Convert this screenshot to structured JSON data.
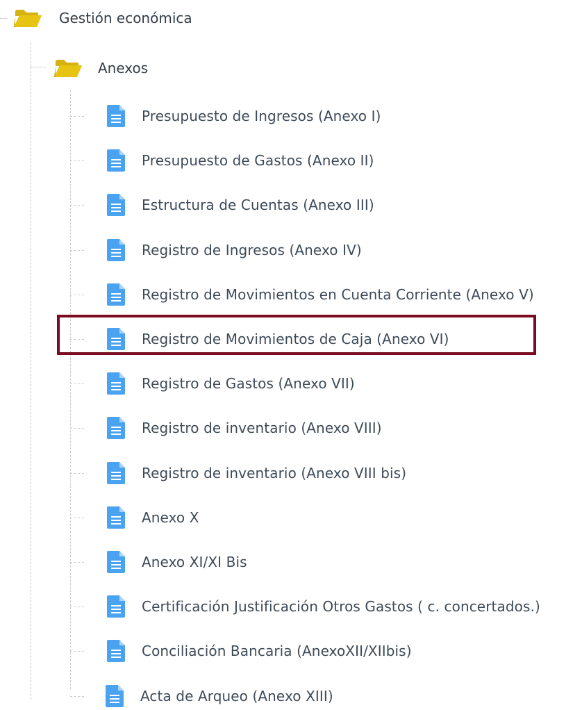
{
  "tree": {
    "root": {
      "label": "Gestión económica",
      "icon": "folder-open-icon"
    },
    "folder": {
      "label": "Anexos",
      "icon": "folder-open-icon"
    },
    "files": [
      {
        "label": "Presupuesto de Ingresos (Anexo I)",
        "icon": "file-text-icon"
      },
      {
        "label": "Presupuesto de Gastos (Anexo II)",
        "icon": "file-text-icon"
      },
      {
        "label": "Estructura de Cuentas (Anexo III)",
        "icon": "file-text-icon"
      },
      {
        "label": "Registro de Ingresos (Anexo IV)",
        "icon": "file-text-icon"
      },
      {
        "label": "Registro de Movimientos en Cuenta Corriente (Anexo V)",
        "icon": "file-text-icon"
      },
      {
        "label": "Registro de Movimientos de Caja (Anexo VI)",
        "icon": "file-text-icon",
        "highlighted": true
      },
      {
        "label": "Registro de Gastos (Anexo VII)",
        "icon": "file-text-icon"
      },
      {
        "label": "Registro de inventario (Anexo VIII)",
        "icon": "file-text-icon"
      },
      {
        "label": "Registro de inventario (Anexo VIII bis)",
        "icon": "file-text-icon"
      },
      {
        "label": "Anexo X",
        "icon": "file-text-icon"
      },
      {
        "label": "Anexo XI/XI Bis",
        "icon": "file-text-icon"
      },
      {
        "label": "Certificación Justificación Otros Gastos ( c. concertados.)",
        "icon": "file-text-icon"
      },
      {
        "label": "Conciliación Bancaria (AnexoXII/XIIbis)",
        "icon": "file-text-icon"
      },
      {
        "label": "Acta de Arqueo (Anexo XIII)",
        "icon": "file-text-icon"
      }
    ]
  },
  "colors": {
    "folder": "#e7c312",
    "file": "#4aa3f0",
    "highlight_border": "#7b0b20",
    "text": "#3d4a57",
    "connector": "#c9c9c9"
  }
}
